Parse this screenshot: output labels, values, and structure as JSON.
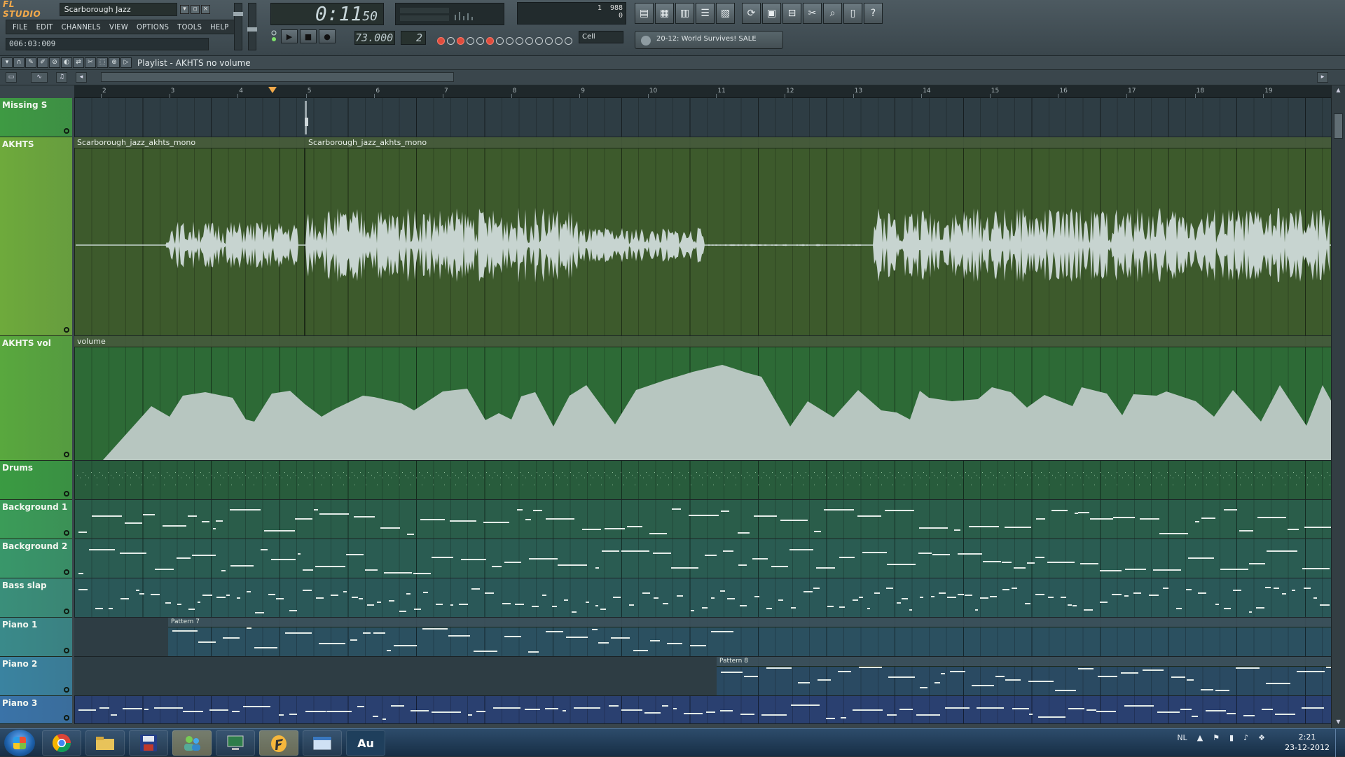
{
  "app": {
    "logo": "FL STUDIO",
    "project_name": "Scarborough Jazz",
    "menu": [
      "FILE",
      "EDIT",
      "CHANNELS",
      "VIEW",
      "OPTIONS",
      "TOOLS",
      "HELP"
    ],
    "position": "006:03:009",
    "time_main": "0:11",
    "time_sub": "50",
    "tempo": "73.000",
    "pattern": "2",
    "cpu_value": "1",
    "poly_value": "988",
    "poly_sub": "0",
    "snap": "Cell",
    "news": "20-12: World Survives! SALE"
  },
  "playlist": {
    "title": "Playlist - AKHTS no volume",
    "bars": [
      "2",
      "3",
      "4",
      "5",
      "6",
      "7",
      "8",
      "9",
      "10",
      "11",
      "12",
      "13",
      "14",
      "15",
      "16",
      "17",
      "18",
      "19"
    ],
    "tracks": [
      {
        "name": "Missing S"
      },
      {
        "name": "AKHTS",
        "clips": [
          "Scarborough_jazz_akhts_mono",
          "Scarborough_jazz_akhts_mono"
        ]
      },
      {
        "name": "AKHTS vol",
        "clips": [
          "volume"
        ]
      },
      {
        "name": "Drums"
      },
      {
        "name": "Background 1"
      },
      {
        "name": "Background 2"
      },
      {
        "name": "Bass slap"
      },
      {
        "name": "Piano 1",
        "clips": [
          "Pattern 7"
        ]
      },
      {
        "name": "Piano 2",
        "clips": [
          "Pattern 8"
        ]
      },
      {
        "name": "Piano 3"
      }
    ]
  },
  "taskbar": {
    "apps": [
      "chrome",
      "explorer",
      "save",
      "users",
      "computer",
      "fl-studio",
      "window",
      "Au"
    ],
    "lang": "NL",
    "time": "2:21",
    "date": "23-12-2012"
  }
}
